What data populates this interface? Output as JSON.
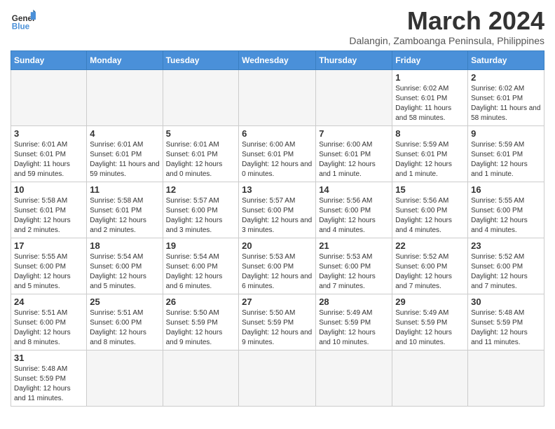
{
  "header": {
    "logo_general": "General",
    "logo_blue": "Blue",
    "month_title": "March 2024",
    "location": "Dalangin, Zamboanga Peninsula, Philippines"
  },
  "days_of_week": [
    "Sunday",
    "Monday",
    "Tuesday",
    "Wednesday",
    "Thursday",
    "Friday",
    "Saturday"
  ],
  "weeks": [
    [
      {
        "day": "",
        "info": ""
      },
      {
        "day": "",
        "info": ""
      },
      {
        "day": "",
        "info": ""
      },
      {
        "day": "",
        "info": ""
      },
      {
        "day": "",
        "info": ""
      },
      {
        "day": "1",
        "info": "Sunrise: 6:02 AM\nSunset: 6:01 PM\nDaylight: 11 hours and 58 minutes."
      },
      {
        "day": "2",
        "info": "Sunrise: 6:02 AM\nSunset: 6:01 PM\nDaylight: 11 hours and 58 minutes."
      }
    ],
    [
      {
        "day": "3",
        "info": "Sunrise: 6:01 AM\nSunset: 6:01 PM\nDaylight: 11 hours and 59 minutes."
      },
      {
        "day": "4",
        "info": "Sunrise: 6:01 AM\nSunset: 6:01 PM\nDaylight: 11 hours and 59 minutes."
      },
      {
        "day": "5",
        "info": "Sunrise: 6:01 AM\nSunset: 6:01 PM\nDaylight: 12 hours and 0 minutes."
      },
      {
        "day": "6",
        "info": "Sunrise: 6:00 AM\nSunset: 6:01 PM\nDaylight: 12 hours and 0 minutes."
      },
      {
        "day": "7",
        "info": "Sunrise: 6:00 AM\nSunset: 6:01 PM\nDaylight: 12 hours and 1 minute."
      },
      {
        "day": "8",
        "info": "Sunrise: 5:59 AM\nSunset: 6:01 PM\nDaylight: 12 hours and 1 minute."
      },
      {
        "day": "9",
        "info": "Sunrise: 5:59 AM\nSunset: 6:01 PM\nDaylight: 12 hours and 1 minute."
      }
    ],
    [
      {
        "day": "10",
        "info": "Sunrise: 5:58 AM\nSunset: 6:01 PM\nDaylight: 12 hours and 2 minutes."
      },
      {
        "day": "11",
        "info": "Sunrise: 5:58 AM\nSunset: 6:01 PM\nDaylight: 12 hours and 2 minutes."
      },
      {
        "day": "12",
        "info": "Sunrise: 5:57 AM\nSunset: 6:00 PM\nDaylight: 12 hours and 3 minutes."
      },
      {
        "day": "13",
        "info": "Sunrise: 5:57 AM\nSunset: 6:00 PM\nDaylight: 12 hours and 3 minutes."
      },
      {
        "day": "14",
        "info": "Sunrise: 5:56 AM\nSunset: 6:00 PM\nDaylight: 12 hours and 4 minutes."
      },
      {
        "day": "15",
        "info": "Sunrise: 5:56 AM\nSunset: 6:00 PM\nDaylight: 12 hours and 4 minutes."
      },
      {
        "day": "16",
        "info": "Sunrise: 5:55 AM\nSunset: 6:00 PM\nDaylight: 12 hours and 4 minutes."
      }
    ],
    [
      {
        "day": "17",
        "info": "Sunrise: 5:55 AM\nSunset: 6:00 PM\nDaylight: 12 hours and 5 minutes."
      },
      {
        "day": "18",
        "info": "Sunrise: 5:54 AM\nSunset: 6:00 PM\nDaylight: 12 hours and 5 minutes."
      },
      {
        "day": "19",
        "info": "Sunrise: 5:54 AM\nSunset: 6:00 PM\nDaylight: 12 hours and 6 minutes."
      },
      {
        "day": "20",
        "info": "Sunrise: 5:53 AM\nSunset: 6:00 PM\nDaylight: 12 hours and 6 minutes."
      },
      {
        "day": "21",
        "info": "Sunrise: 5:53 AM\nSunset: 6:00 PM\nDaylight: 12 hours and 7 minutes."
      },
      {
        "day": "22",
        "info": "Sunrise: 5:52 AM\nSunset: 6:00 PM\nDaylight: 12 hours and 7 minutes."
      },
      {
        "day": "23",
        "info": "Sunrise: 5:52 AM\nSunset: 6:00 PM\nDaylight: 12 hours and 7 minutes."
      }
    ],
    [
      {
        "day": "24",
        "info": "Sunrise: 5:51 AM\nSunset: 6:00 PM\nDaylight: 12 hours and 8 minutes."
      },
      {
        "day": "25",
        "info": "Sunrise: 5:51 AM\nSunset: 6:00 PM\nDaylight: 12 hours and 8 minutes."
      },
      {
        "day": "26",
        "info": "Sunrise: 5:50 AM\nSunset: 5:59 PM\nDaylight: 12 hours and 9 minutes."
      },
      {
        "day": "27",
        "info": "Sunrise: 5:50 AM\nSunset: 5:59 PM\nDaylight: 12 hours and 9 minutes."
      },
      {
        "day": "28",
        "info": "Sunrise: 5:49 AM\nSunset: 5:59 PM\nDaylight: 12 hours and 10 minutes."
      },
      {
        "day": "29",
        "info": "Sunrise: 5:49 AM\nSunset: 5:59 PM\nDaylight: 12 hours and 10 minutes."
      },
      {
        "day": "30",
        "info": "Sunrise: 5:48 AM\nSunset: 5:59 PM\nDaylight: 12 hours and 11 minutes."
      }
    ],
    [
      {
        "day": "31",
        "info": "Sunrise: 5:48 AM\nSunset: 5:59 PM\nDaylight: 12 hours and 11 minutes."
      },
      {
        "day": "",
        "info": ""
      },
      {
        "day": "",
        "info": ""
      },
      {
        "day": "",
        "info": ""
      },
      {
        "day": "",
        "info": ""
      },
      {
        "day": "",
        "info": ""
      },
      {
        "day": "",
        "info": ""
      }
    ]
  ]
}
